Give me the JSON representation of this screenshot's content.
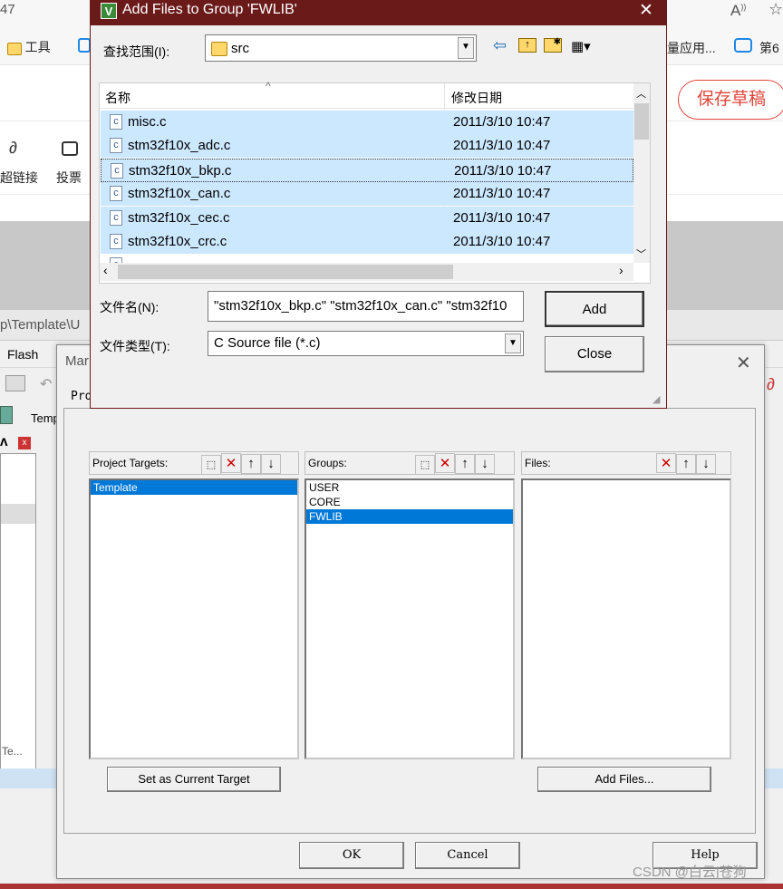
{
  "browser": {
    "top_left_text": "47",
    "bookmark_tools": "工具",
    "bookmark_right1": "量应用...",
    "bookmark_right2": "第6",
    "save_draft": "保存草稿",
    "tool_link": "超链接",
    "tool_vote": "投票"
  },
  "ide": {
    "path_text": "p\\Template\\U",
    "menu_flash": "Flash",
    "toolbar_label": "Temp",
    "status_text": "Te...",
    "watermark": "CSDN @白云|苍狗"
  },
  "manage_dialog": {
    "title": "Mar",
    "tab_label": "Pro",
    "targets_header": "Project Targets:",
    "groups_header": "Groups:",
    "files_header": "Files:",
    "targets": [
      "Template"
    ],
    "groups": [
      "USER",
      "CORE",
      "FWLIB"
    ],
    "selected_group": "FWLIB",
    "set_target_button": "Set as Current Target",
    "add_files_button": "Add Files...",
    "ok_button": "OK",
    "cancel_button": "Cancel",
    "help_button": "Help"
  },
  "add_dialog": {
    "title": "Add Files to Group 'FWLIB'",
    "lookin_label": "查找范围(I):",
    "lookin_value": "src",
    "col_name": "名称",
    "col_date": "修改日期",
    "files": [
      {
        "name": "misc.c",
        "date": "2011/3/10 10:47"
      },
      {
        "name": "stm32f10x_adc.c",
        "date": "2011/3/10 10:47"
      },
      {
        "name": "stm32f10x_bkp.c",
        "date": "2011/3/10 10:47"
      },
      {
        "name": "stm32f10x_can.c",
        "date": "2011/3/10 10:47"
      },
      {
        "name": "stm32f10x_cec.c",
        "date": "2011/3/10 10:47"
      },
      {
        "name": "stm32f10x_crc.c",
        "date": "2011/3/10 10:47"
      }
    ],
    "filename_label": "文件名(N):",
    "filename_value": "\"stm32f10x_bkp.c\" \"stm32f10x_can.c\" \"stm32f10",
    "filetype_label": "文件类型(T):",
    "filetype_value": "C Source file (*.c)",
    "add_button": "Add",
    "close_button": "Close"
  },
  "colors": {
    "title_bar": "#6b1a1a",
    "selection": "#0078d7",
    "row_select": "#cce8ff",
    "save_draft": "#e0443a"
  }
}
